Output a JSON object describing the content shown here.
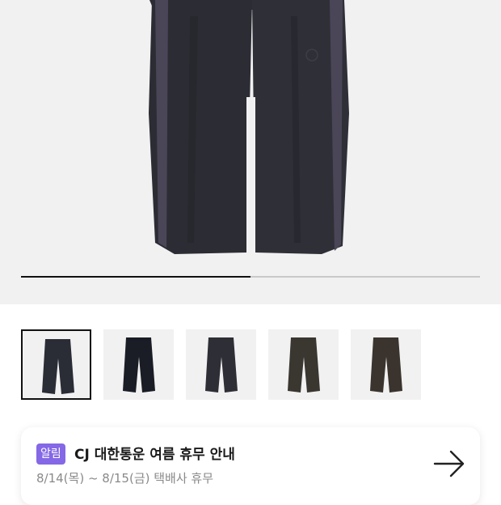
{
  "product_gallery": {
    "slide_progress": 0.5,
    "thumbnails": [
      {
        "icon": "navy-track-pants-thumbnail",
        "color": "#2a2c36",
        "selected": true
      },
      {
        "icon": "black-track-pants-thumbnail",
        "color": "#1a1d26",
        "selected": false
      },
      {
        "icon": "charcoal-track-pants-thumbnail",
        "color": "#2e2e36",
        "selected": false
      },
      {
        "icon": "brown-track-pants-thumbnail",
        "color": "#3a3630",
        "selected": false
      },
      {
        "icon": "dark-brown-track-pants-thumbnail",
        "color": "#3b342e",
        "selected": false
      }
    ]
  },
  "notice": {
    "badge": "알림",
    "title": "CJ 대한통운 여름 휴무 안내",
    "subtitle": "8/14(목) ~ 8/15(금) 택배사 휴무",
    "arrow_icon": "arrow-right-icon"
  }
}
